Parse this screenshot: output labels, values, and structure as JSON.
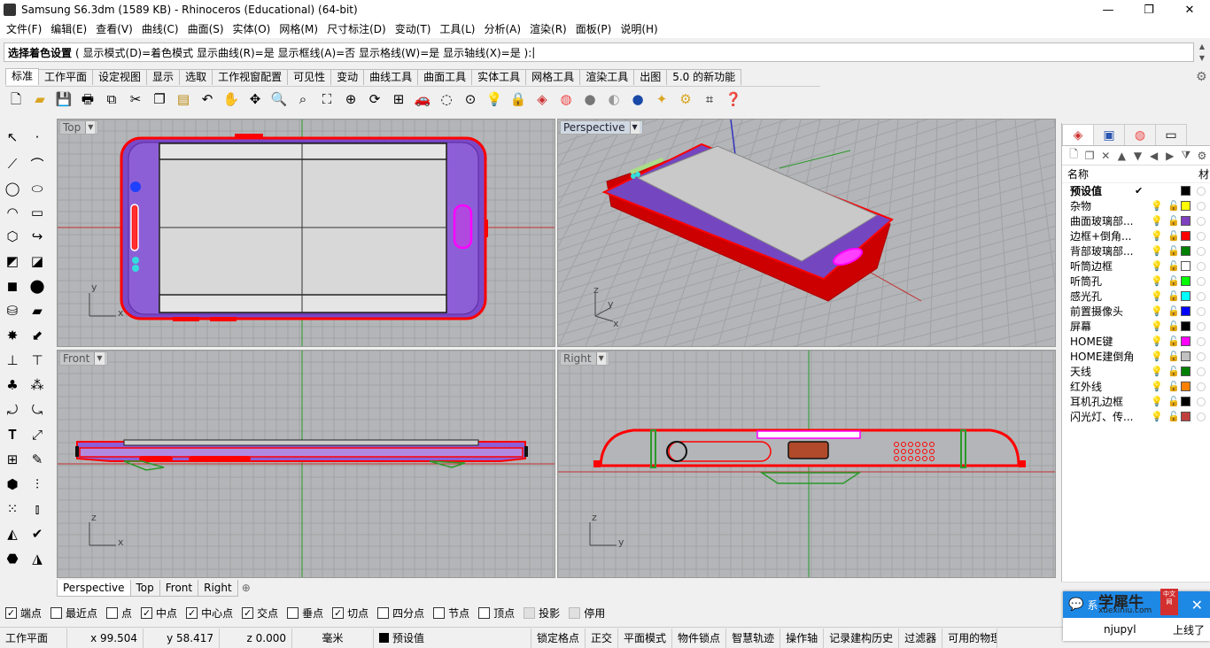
{
  "window": {
    "title": "Samsung S6.3dm (1589 KB) - Rhinoceros (Educational) (64-bit)"
  },
  "menu": [
    "文件(F)",
    "编辑(E)",
    "查看(V)",
    "曲线(C)",
    "曲面(S)",
    "实体(O)",
    "网格(M)",
    "尺寸标注(D)",
    "变动(T)",
    "工具(L)",
    "分析(A)",
    "渲染(R)",
    "面板(P)",
    "说明(H)"
  ],
  "command": {
    "prompt": "选择着色设置",
    "options": "( 显示模式(D)=着色模式  显示曲线(R)=是  显示框线(A)=否  显示格线(W)=是  显示轴线(X)=是 ):"
  },
  "tabs": [
    "标准",
    "工作平面",
    "设定视图",
    "显示",
    "选取",
    "工作视窗配置",
    "可见性",
    "变动",
    "曲线工具",
    "曲面工具",
    "实体工具",
    "网格工具",
    "渲染工具",
    "出图",
    "5.0 的新功能"
  ],
  "toolbar_icons": [
    "new-file-icon",
    "open-file-icon",
    "save-icon",
    "print-icon",
    "import-icon",
    "cut-icon",
    "copy-icon",
    "paste-icon",
    "undo-icon",
    "pan-icon",
    "rotate-view-icon",
    "zoom-icon",
    "zoom-window-icon",
    "zoom-extents-icon",
    "zoom-selected-icon",
    "rotate-icon",
    "four-view-icon",
    "car-icon",
    "hide-icon",
    "show-icon",
    "lock-icon",
    "layers-icon",
    "color-wheel-icon",
    "shaded-sphere-icon",
    "rendered-sphere-icon",
    "render-icon",
    "light-icon",
    "gear-icon",
    "grid-icon",
    "help-icon"
  ],
  "viewports": {
    "top": {
      "label": "Top",
      "axis_x": "x",
      "axis_y": "y"
    },
    "perspective": {
      "label": "Perspective",
      "axis_x": "x",
      "axis_y": "y",
      "axis_z": "z"
    },
    "front": {
      "label": "Front",
      "axis_x": "x",
      "axis_y": "z"
    },
    "right": {
      "label": "Right",
      "axis_x": "y",
      "axis_y": "z"
    }
  },
  "view_tabs": [
    "Perspective",
    "Top",
    "Front",
    "Right"
  ],
  "osnaps": [
    {
      "label": "端点",
      "checked": true
    },
    {
      "label": "最近点",
      "checked": false
    },
    {
      "label": "点",
      "checked": false
    },
    {
      "label": "中点",
      "checked": true
    },
    {
      "label": "中心点",
      "checked": true
    },
    {
      "label": "交点",
      "checked": true
    },
    {
      "label": "垂点",
      "checked": false
    },
    {
      "label": "切点",
      "checked": true
    },
    {
      "label": "四分点",
      "checked": false
    },
    {
      "label": "节点",
      "checked": false
    },
    {
      "label": "顶点",
      "checked": false
    },
    {
      "label": "投影",
      "checked": false
    },
    {
      "label": "停用",
      "checked": false
    }
  ],
  "status": {
    "cplane": "工作平面",
    "x": "x 99.504",
    "y": "y 58.417",
    "z": "z 0.000",
    "units": "毫米",
    "layer": "预设值",
    "buttons": [
      "锁定格点",
      "正交",
      "平面模式",
      "物件锁点",
      "智慧轨迹",
      "操作轴",
      "记录建构历史",
      "过滤器",
      "可用的物理"
    ]
  },
  "layers_panel": {
    "header_name": "名称",
    "header_material": "材",
    "layers": [
      {
        "name": "预设值",
        "color": "#000000",
        "current": true
      },
      {
        "name": "杂物",
        "color": "#ffff00"
      },
      {
        "name": "曲面玻璃部...",
        "color": "#7f3fbf"
      },
      {
        "name": "边框+倒角...",
        "color": "#ff0000"
      },
      {
        "name": "背部玻璃部...",
        "color": "#008000"
      },
      {
        "name": "听筒边框",
        "color": "#ffffff"
      },
      {
        "name": "听筒孔",
        "color": "#00ff00"
      },
      {
        "name": "感光孔",
        "color": "#00ffff"
      },
      {
        "name": "前置摄像头",
        "color": "#0000ff"
      },
      {
        "name": "屏幕",
        "color": "#000000"
      },
      {
        "name": "HOME键",
        "color": "#ff00ff"
      },
      {
        "name": "HOME建倒角",
        "color": "#c0c0c0"
      },
      {
        "name": "天线",
        "color": "#008000"
      },
      {
        "name": "红外线",
        "color": "#ff8000"
      },
      {
        "name": "耳机孔边框",
        "color": "#000000"
      },
      {
        "name": "闪光灯、传...",
        "color": "#c04040"
      }
    ]
  },
  "toast": {
    "brand": "学犀牛",
    "site": "xuexiniu.com",
    "badge": "中文网",
    "left_text": "系",
    "user": "njupyl",
    "message": "上线了"
  },
  "colors": {
    "viewport_bg": "#b3b5b8",
    "grid": "#a3a5a8",
    "accent": "#1e88e5"
  }
}
